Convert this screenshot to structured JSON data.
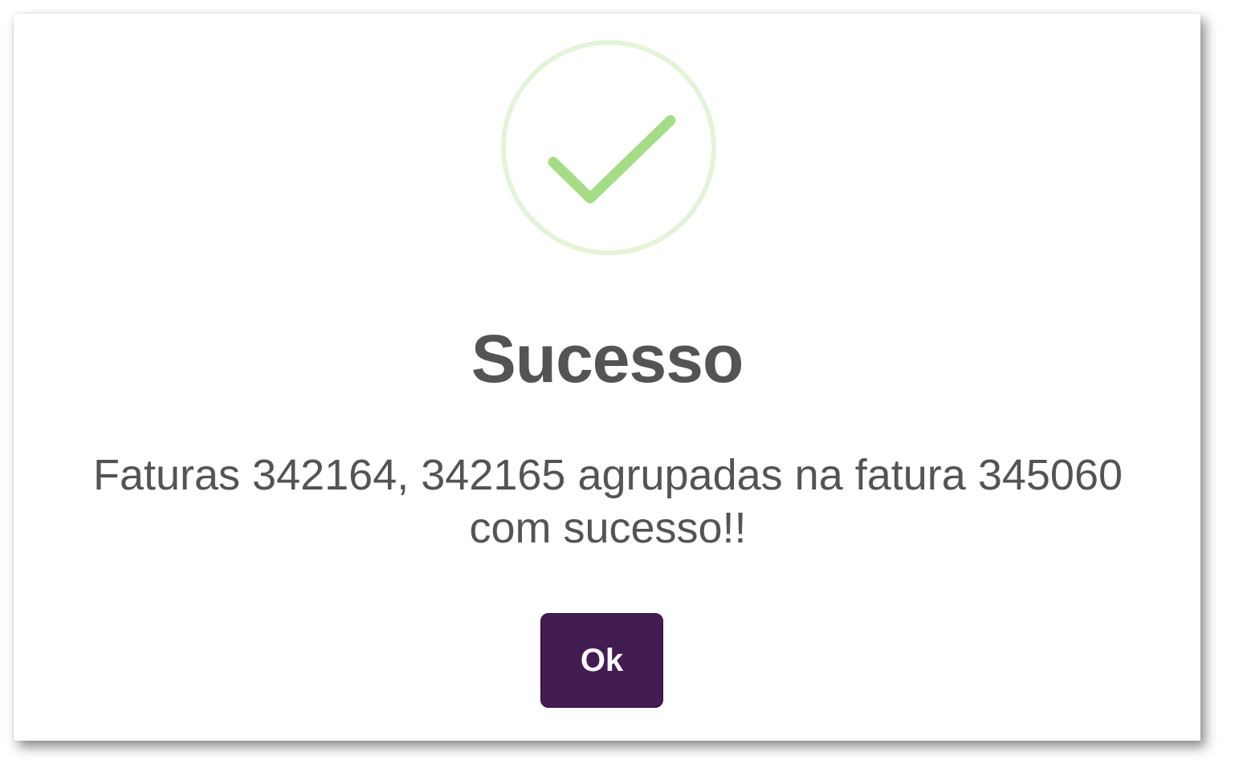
{
  "dialog": {
    "icon": "success-check-icon",
    "title": "Sucesso",
    "message": "Faturas 342164, 342165 agrupadas na fatura 345060 com sucesso!!",
    "ok_label": "Ok"
  },
  "colors": {
    "check_stroke": "#a5dc86",
    "check_ring": "#e3f4d9",
    "title_text": "#545454",
    "button_background": "#421c52",
    "button_text": "#ffffff"
  }
}
